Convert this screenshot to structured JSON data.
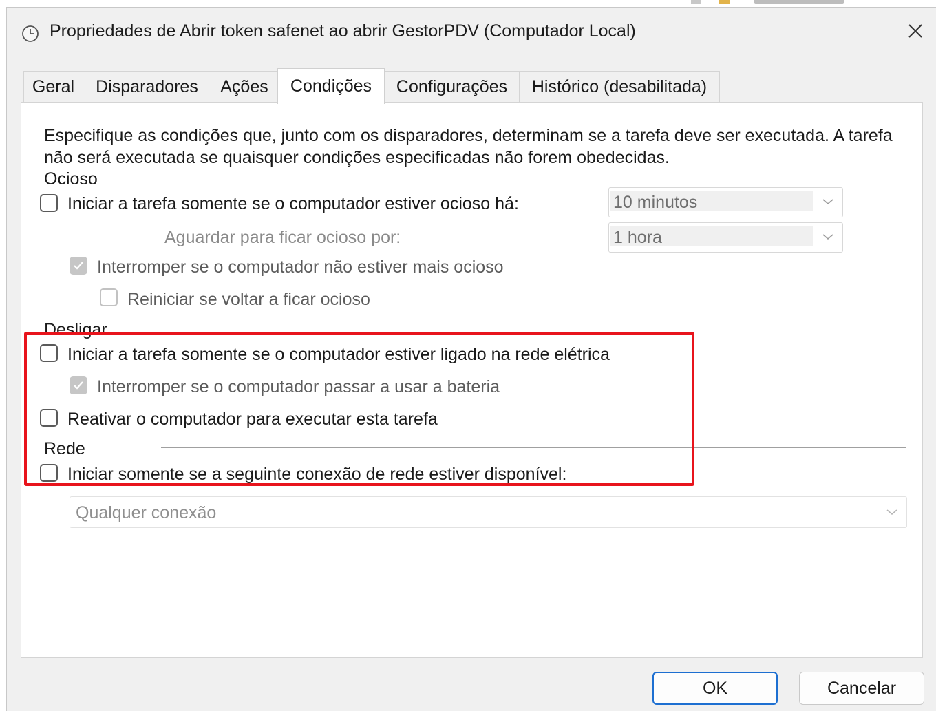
{
  "window": {
    "title": "Propriedades de Abrir token safenet ao abrir GestorPDV (Computador Local)",
    "icon": "clock-icon",
    "close_icon": "close-icon"
  },
  "tabs": [
    {
      "label": "Geral",
      "active": false
    },
    {
      "label": "Disparadores",
      "active": false
    },
    {
      "label": "Ações",
      "active": false
    },
    {
      "label": "Condições",
      "active": true
    },
    {
      "label": "Configurações",
      "active": false
    },
    {
      "label": "Histórico (desabilitada)",
      "active": false
    }
  ],
  "description": "Especifique as condições que, junto com os disparadores, determinam se a tarefa deve ser executada. A tarefa não será executada se quaisquer condições especificadas não forem obedecidas.",
  "idle": {
    "group_label": "Ocioso",
    "start_only_if_idle": {
      "label": "Iniciar a tarefa somente se o computador estiver ocioso há:",
      "checked": false
    },
    "idle_for_value": "10 minutos",
    "wait_label": "Aguardar para ficar ocioso por:",
    "wait_value": "1 hora",
    "stop_if_not_idle": {
      "label": "Interromper se o computador não estiver mais ocioso",
      "checked": true,
      "enabled": false
    },
    "restart_if_idle": {
      "label": "Reiniciar se voltar a ficar ocioso",
      "checked": false,
      "enabled": false
    }
  },
  "power": {
    "group_label": "Desligar",
    "start_only_on_ac": {
      "label": "Iniciar a tarefa somente se o computador estiver ligado na rede elétrica",
      "checked": false
    },
    "stop_on_battery": {
      "label": "Interromper se o computador passar a usar a bateria",
      "checked": true,
      "enabled": false
    },
    "wake_to_run": {
      "label": "Reativar o computador para executar esta tarefa",
      "checked": false
    }
  },
  "network": {
    "group_label": "Rede",
    "start_only_if_network": {
      "label": "Iniciar somente se a seguinte conexão de rede estiver disponível:",
      "checked": false
    },
    "connection_value": "Qualquer conexão"
  },
  "buttons": {
    "ok": "OK",
    "cancel": "Cancelar"
  },
  "colors": {
    "highlight_border": "#e8141c",
    "primary_button_border": "#1d6fd1"
  }
}
